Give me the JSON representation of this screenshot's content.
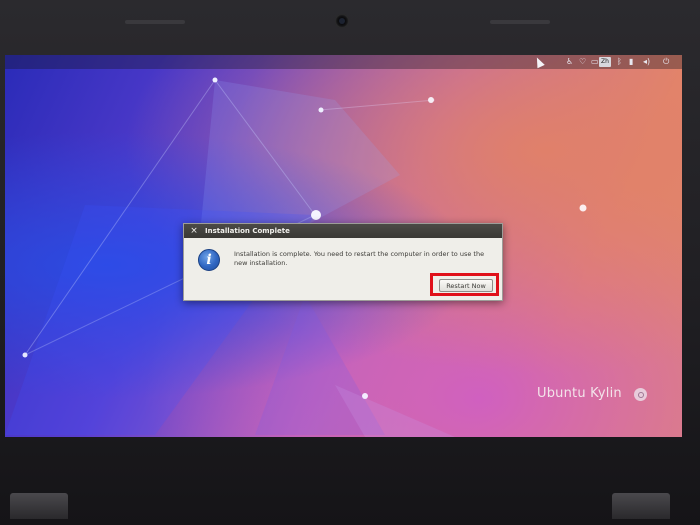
{
  "dialog": {
    "title": "Installation Complete",
    "close_glyph": "×",
    "icon": "info-icon",
    "icon_glyph": "i",
    "message": "Installation is complete. You need to restart the computer in order to use the new installation.",
    "restart_button_label": "Restart Now"
  },
  "panel": {
    "indicators": [
      "accessibility-icon",
      "network-icon",
      "keyboard-layout-indicator",
      "bluetooth-icon",
      "battery-icon",
      "volume-icon",
      "power-icon"
    ],
    "keyboard_layout": "Zh"
  },
  "desktop": {
    "branding_text": "Ubuntu Kylin",
    "branding_logo": "ubuntu-logo-icon"
  },
  "colors": {
    "highlight": "#e0101a",
    "dialog_titlebar": "#3a3935",
    "dialog_body": "#efeee9",
    "wallpaper_blue": "#2a2bb8",
    "wallpaper_orange": "#e4876a"
  }
}
